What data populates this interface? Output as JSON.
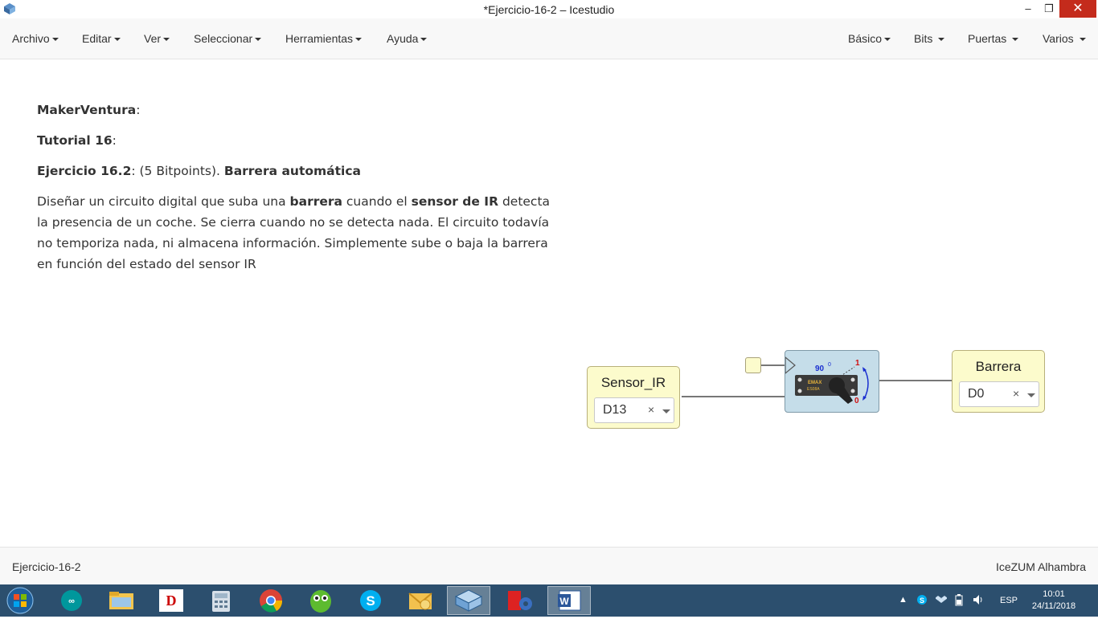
{
  "window": {
    "title": "*Ejercicio-16-2 – Icestudio",
    "minimize": "–",
    "maximize": "❐",
    "close": "✕",
    "app_icon": "icestudio-icon"
  },
  "menubar": {
    "left": [
      {
        "label": "Archivo"
      },
      {
        "label": "Editar"
      },
      {
        "label": "Ver"
      },
      {
        "label": "Seleccionar"
      },
      {
        "label": "Herramientas"
      },
      {
        "label": "Ayuda"
      }
    ],
    "right": [
      {
        "label": "Básico"
      },
      {
        "label": "Bits"
      },
      {
        "label": "Puertas"
      },
      {
        "label": "Varios"
      }
    ]
  },
  "info": {
    "l1_bold": "MakerVentura",
    "l1_rest": ":",
    "l2_bold": "Tutorial 16",
    "l2_rest": ":",
    "l3_bold": "Ejercicio 16.2",
    "l3_mid": ": (5 Bitpoints). ",
    "l3_bold2": "Barrera automática",
    "p_a": "Diseñar un circuito digital que suba una ",
    "p_b": "barrera",
    "p_c": " cuando el ",
    "p_d": "sensor de IR",
    "p_e": " detecta la presencia de un coche. Se cierra cuando no se detecta nada. El circuito todavía no temporiza nada, ni almacena información. Simplemente sube o baja la barrera en función del estado del sensor IR"
  },
  "circuit": {
    "input_block": {
      "label": "Sensor_IR",
      "pin": "D13",
      "clear": "×"
    },
    "output_block": {
      "label": "Barrera",
      "pin": "D0",
      "clear": "×"
    },
    "servo": {
      "angle": "90",
      "deg": "0",
      "top": "1",
      "bottom": "0",
      "brand": "EMAX",
      "model": "ES08A"
    }
  },
  "statusbar": {
    "file": "Ejercicio-16-2",
    "board": "IceZUM Alhambra"
  },
  "taskbar": {
    "apps": [
      "arduino-icon",
      "file-explorer-icon",
      "fritzing-icon",
      "calculator-icon",
      "chrome-icon",
      "owl-icon",
      "skype-icon",
      "outlook-icon",
      "icestudio-icon",
      "freecad-icon",
      "word-icon"
    ],
    "lang": "ESP",
    "time": "10:01",
    "date": "24/11/2018"
  }
}
